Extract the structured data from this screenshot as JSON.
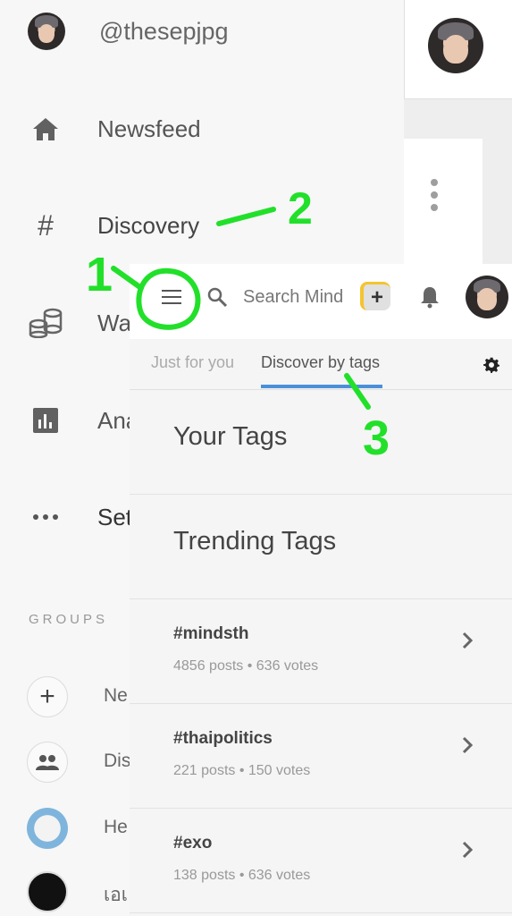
{
  "drawer": {
    "username": "@thesepjpg",
    "items": [
      {
        "label": "Newsfeed",
        "icon": "home-icon"
      },
      {
        "label": "Discovery",
        "icon": "hash-icon"
      },
      {
        "label": "Wa",
        "icon": "coins-icon"
      },
      {
        "label": "Ana",
        "icon": "bar-chart-icon"
      },
      {
        "label": "Set",
        "icon": "more-horiz-icon"
      }
    ],
    "groups_heading": "GROUPS",
    "groups": [
      {
        "label": "Ne",
        "icon": "plus-icon"
      },
      {
        "label": "Dis",
        "icon": "people-icon"
      },
      {
        "label": "He",
        "icon": "group-avatar-icon"
      },
      {
        "label": "เอเ",
        "icon": "group-logo-icon"
      }
    ]
  },
  "topbar": {
    "search_placeholder": "Search Mind",
    "plus_label": "+"
  },
  "tabs": [
    {
      "label": "Just for you",
      "active": false
    },
    {
      "label": "Discover by tags",
      "active": true
    }
  ],
  "sections": {
    "your_tags": "Your Tags",
    "trending_tags": "Trending Tags"
  },
  "trending": [
    {
      "tag": "#mindsth",
      "stats": "4856 posts • 636 votes"
    },
    {
      "tag": "#thaipolitics",
      "stats": "221 posts • 150 votes"
    },
    {
      "tag": "#exo",
      "stats": "138 posts • 636 votes"
    }
  ],
  "annotations": [
    "1",
    "2",
    "3"
  ],
  "colors": {
    "accent": "#4a90d9",
    "annotation": "#22e02a",
    "plus_button_highlight": "#f4c430"
  }
}
